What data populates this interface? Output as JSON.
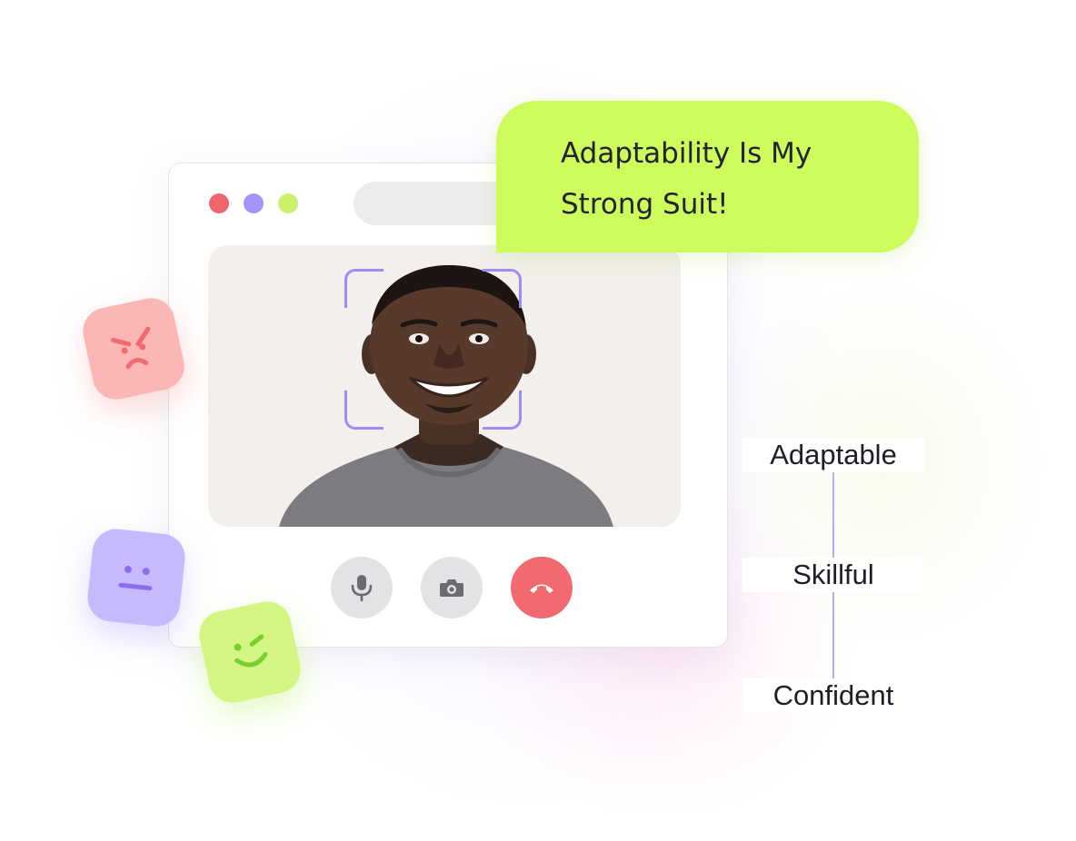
{
  "window": {
    "traffic_lights": [
      "#f0646b",
      "#a394f7",
      "#c9f26a"
    ]
  },
  "video_call": {
    "face_frame_color": "#9f8cf2",
    "controls": [
      {
        "name": "microphone",
        "icon": "microphone-icon"
      },
      {
        "name": "camera",
        "icon": "camera-icon"
      },
      {
        "name": "end-call",
        "icon": "phone-hangup-icon",
        "color": "#f26a6f"
      }
    ]
  },
  "speech_bubble": {
    "line1": "Adaptability Is My",
    "line2": "Strong Suit!",
    "color": "#cdfb5c"
  },
  "emotion_icons": [
    {
      "mood": "angry",
      "icon": "angry-face-icon",
      "color": "#fbb6b6"
    },
    {
      "mood": "neutral",
      "icon": "neutral-face-icon",
      "color": "#c7b9fd"
    },
    {
      "mood": "wink",
      "icon": "winking-face-icon",
      "color": "#d3f583"
    }
  ],
  "traits": [
    "Adaptable",
    "Skillful",
    "Confident"
  ]
}
